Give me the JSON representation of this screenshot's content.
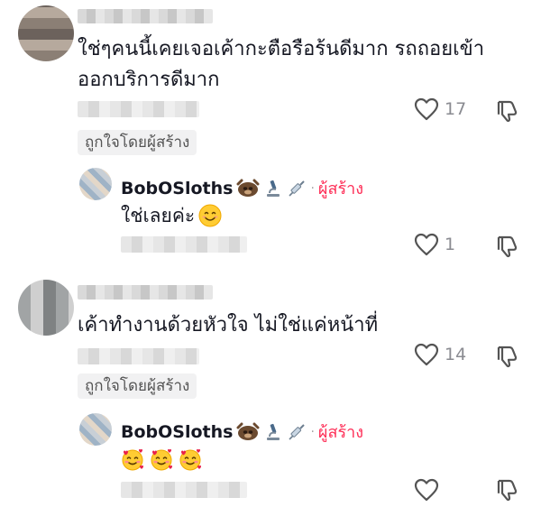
{
  "comments": [
    {
      "text": "ใช่ๆคนนี้เคยเจอเค้ากะตือรือร้นดีมาก รถถอยเข้าออกบริการดีมาก",
      "likes": "17",
      "creator_liked_label": "ถูกใจโดยผู้สร้าง",
      "reply": {
        "username": "BobOSloths",
        "author_label": "ผู้สร้าง",
        "text": "ใช่เลยค่ะ",
        "likes": "1"
      }
    },
    {
      "text": "เค้าทำงานด้วยหัวใจ ไม่ใช่แค่หน้าที่",
      "likes": "14",
      "creator_liked_label": "ถูกใจโดยผู้สร้าง",
      "reply": {
        "username": "BobOSloths",
        "author_label": "ผู้สร้าง",
        "text": "",
        "likes": ""
      }
    }
  ],
  "icons": {
    "like": "heart-outline-icon",
    "dislike": "thumbs-down-icon",
    "reply_emoji": "smiling-face-icon",
    "love_emoji": "smiling-face-with-hearts-icon",
    "badges": [
      "sloth-icon",
      "microscope-icon",
      "syringe-icon"
    ]
  },
  "colors": {
    "author": "#fe2c55",
    "muted": "#8a8b91",
    "text": "#161823"
  }
}
